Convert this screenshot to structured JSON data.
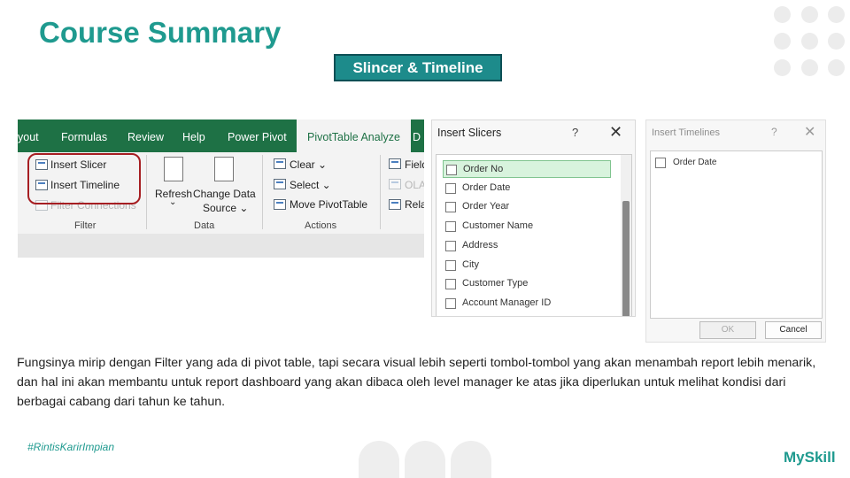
{
  "slide": {
    "title": "Course Summary",
    "subtitle": "Slincer & Timeline",
    "description": "Fungsinya mirip dengan Filter yang ada di pivot table, tapi secara visual lebih seperti  tombol-tombol yang akan menambah report lebih menarik, dan hal ini akan membantu untuk report dashboard yang akan dibaca oleh level manager  ke atas jika diperlukan untuk melihat kondisi dari berbagai cabang dari tahun ke tahun.",
    "hashtag": "#RintisKarirImpian",
    "brand": "MySkill",
    "accent_color": "#1f9a8f"
  },
  "ribbon": {
    "tabs": [
      "yout",
      "Formulas",
      "Review",
      "Help",
      "Power Pivot",
      "PivotTable Analyze",
      "D"
    ],
    "active_tab": "PivotTable Analyze",
    "filter_group": {
      "label": "Filter",
      "items": [
        "Insert Slicer",
        "Insert Timeline",
        "Filter Connections"
      ]
    },
    "data_group": {
      "label": "Data",
      "refresh": "Refresh",
      "refresh_arrow": "⌄",
      "change_source_1": "Change Data",
      "change_source_2": "Source ⌄"
    },
    "actions_group": {
      "label": "Actions",
      "items": [
        "Clear ⌄",
        "Select ⌄",
        "Move PivotTable"
      ]
    },
    "extra_group": {
      "items": [
        "Field",
        "OLA",
        "Rela"
      ]
    },
    "tab_color": "#1e7145"
  },
  "insert_slicers": {
    "title": "Insert Slicers",
    "help": "?",
    "close": "✕",
    "fields": [
      "Order No",
      "Order Date",
      "Order Year",
      "Customer Name",
      "Address",
      "City",
      "Customer Type",
      "Account Manager ID"
    ],
    "selected": "Order No"
  },
  "insert_timelines": {
    "title": "Insert Timelines",
    "help": "?",
    "close": "✕",
    "fields": [
      "Order Date"
    ],
    "ok": "OK",
    "cancel": "Cancel"
  }
}
